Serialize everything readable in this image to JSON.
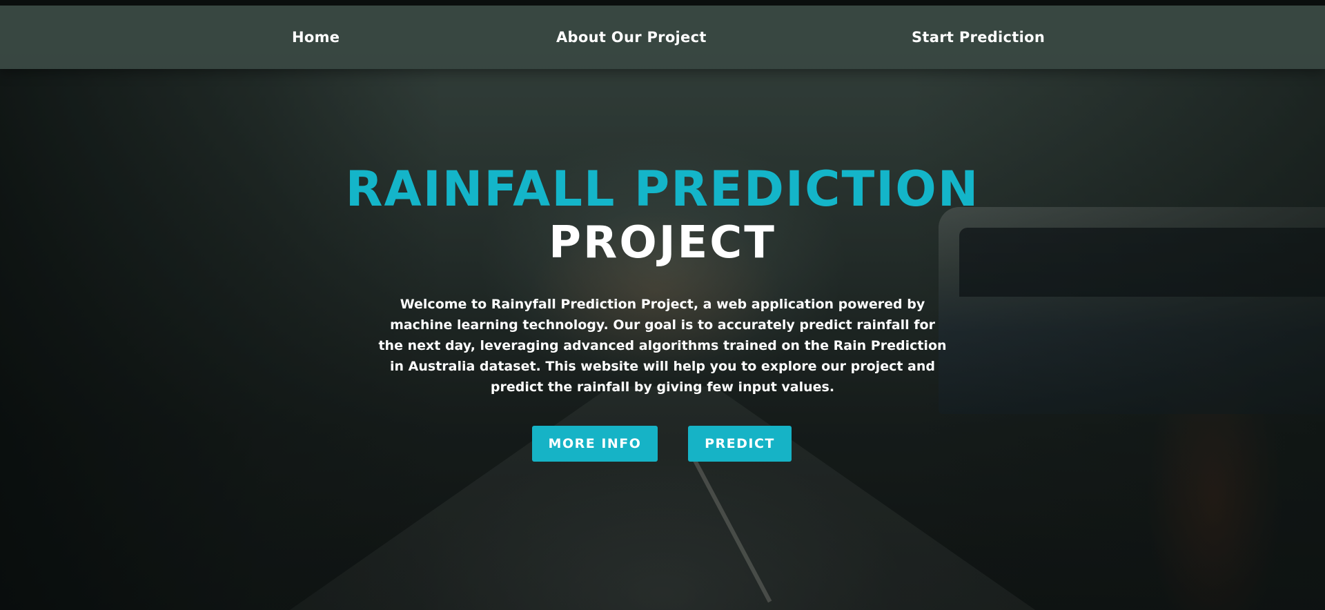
{
  "nav": {
    "home": "Home",
    "about": "About Our Project",
    "start": "Start Prediction"
  },
  "hero": {
    "title_line1": "RAINFALL PREDICTION",
    "title_line2": "PROJECT",
    "description": "Welcome to Rainyfall Prediction Project, a web application powered by machine learning technology. Our goal is to accurately predict rainfall for the next day, leveraging advanced algorithms trained on the Rain Prediction in Australia dataset. This website will help you to explore our project and predict the rainfall by giving few input values.",
    "buttons": {
      "more_info": "MORE INFO",
      "predict": "PREDICT"
    }
  },
  "colors": {
    "accent": "#16b3c6",
    "navbar": "#384842",
    "text": "#ffffff"
  }
}
